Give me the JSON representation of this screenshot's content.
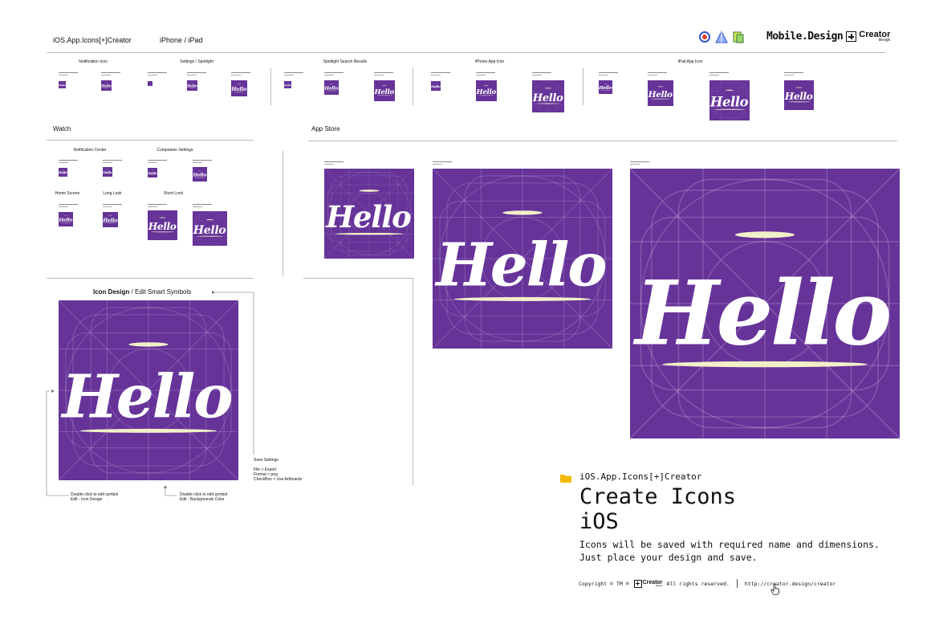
{
  "header": {
    "app_title": "iOS.App.Icons[+]Creator",
    "device_tab": "iPhone / iPad",
    "brand_text": "Mobile.Design",
    "brand_creator": "Creator",
    "brand_sub": "design"
  },
  "icon_text": "Hello",
  "colors": {
    "icon_bg": "#663399",
    "accent_bar": "#f2f0c8",
    "folder": "#f5b800"
  },
  "sections": {
    "notification_icon": "Notification Icon",
    "settings_spotlight": "Settings / Spotlight",
    "spotlight_results": "Spotlight Search Results",
    "iphone_app_icon": "iPhone App Icon",
    "ipad_app_icon": "iPad App Icon",
    "watch": "Watch",
    "app_store": "App Store",
    "notification_center": "Notification Center",
    "companion_settings": "Companion Settings",
    "home_screen": "Home Screen",
    "long_look": "Long Look",
    "short_look": "Short Look"
  },
  "icon_design": {
    "title_bold": "Icon Design",
    "title_rest": " / Edit Smart Symbols",
    "save_settings": [
      "Save Settings",
      "",
      "File > Export",
      "Format > png",
      "CheckBox > Use Artboards"
    ],
    "edit_symbol_1": [
      "Double click to edit symbol",
      "Edit - Icon Design"
    ],
    "edit_symbol_2": [
      "Double click to edit symbol",
      "Edit - Backgrounds Color"
    ]
  },
  "info": {
    "folder_title": "iOS.App.Icons[+]Creator",
    "headline_1": "Create Icons",
    "headline_2": "iOS",
    "desc_1": "Icons will be saved with required name and dimensions.",
    "desc_2": "Just place your design and save.",
    "copyright": "Copyright © TM ®",
    "rights": "All rights reserved.",
    "url": "http://creator.design/creator"
  }
}
